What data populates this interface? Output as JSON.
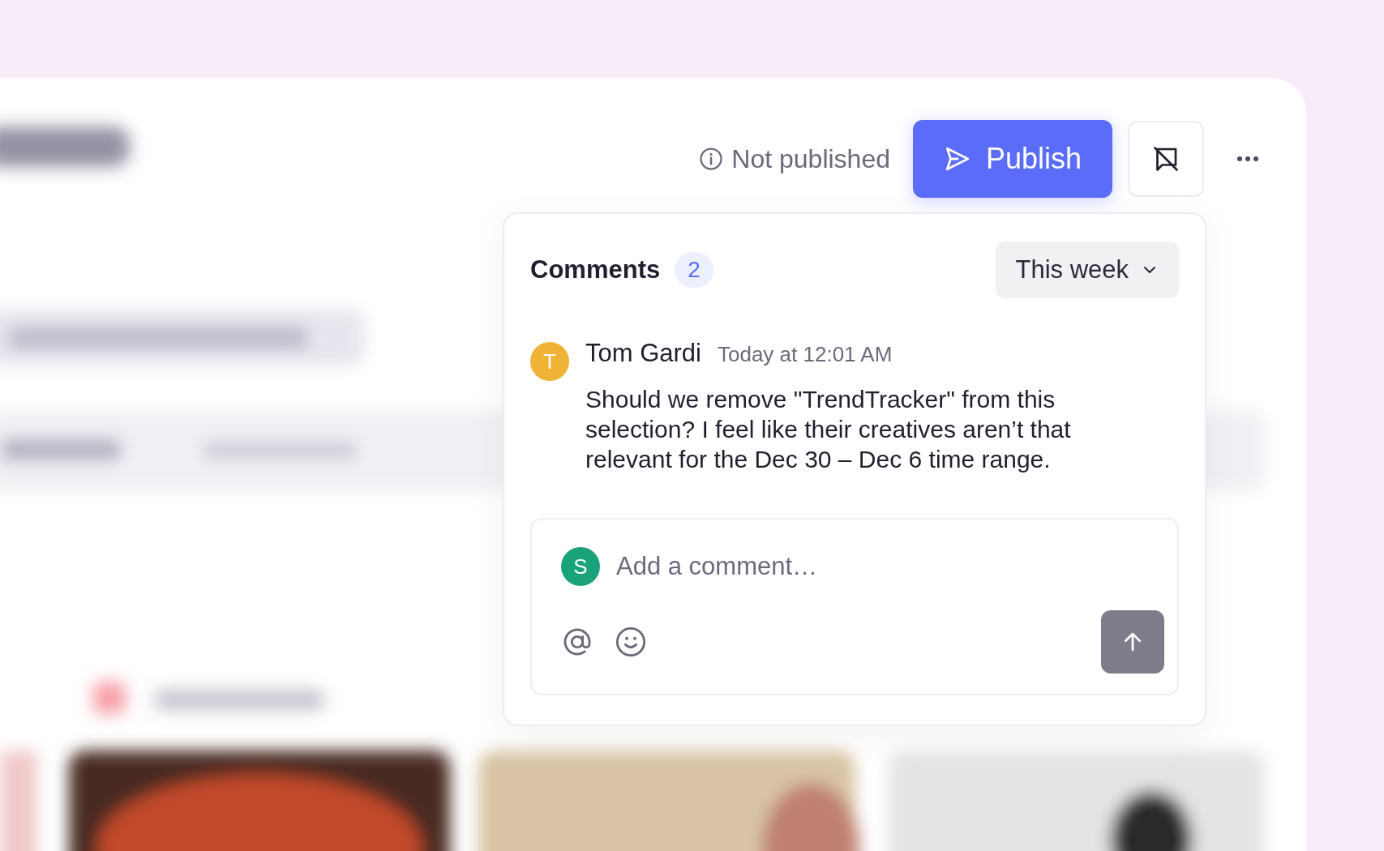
{
  "header": {
    "status": "Not published",
    "publish_button": "Publish"
  },
  "comments": {
    "title": "Comments",
    "count": "2",
    "filter": "This week",
    "items": [
      {
        "author": "Tom Gardi",
        "initial": "T",
        "color": "#efb435",
        "time": "Today at 12:01 AM",
        "text": "Should we remove \"TrendTracker\" from this selection? I feel like their creatives aren’t that relevant for the Dec 30 – Dec 6 time range."
      }
    ],
    "composer": {
      "initial": "S",
      "color": "#1aa37a",
      "placeholder": "Add a comment…",
      "send_disabled": true
    }
  }
}
